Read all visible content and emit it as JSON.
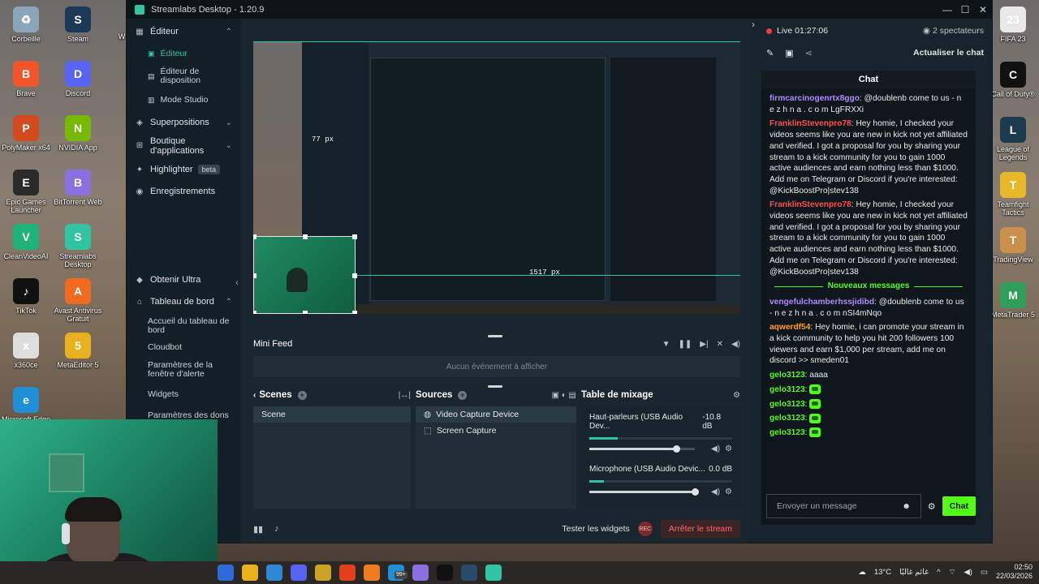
{
  "desktop": {
    "icons_left": [
      {
        "label": "Corbeille",
        "name": "recycle-bin-icon",
        "color": "#8aa4b8",
        "glyph": "♻"
      },
      {
        "label": "Brave",
        "name": "brave-icon",
        "color": "#f1562b",
        "glyph": "B"
      },
      {
        "label": "PolyMaker x64",
        "name": "polymaker-icon",
        "color": "#d34a1f",
        "glyph": "P"
      },
      {
        "label": "Epic Games Launcher",
        "name": "epic-games-icon",
        "color": "#2a2a2a",
        "glyph": "E"
      },
      {
        "label": "CleanVideoAI",
        "name": "cleanvideoai-icon",
        "color": "#1db37b",
        "glyph": "V"
      },
      {
        "label": "TikTok",
        "name": "tiktok-icon",
        "color": "#111111",
        "glyph": "♪"
      },
      {
        "label": "x360ce",
        "name": "x360ce-icon",
        "color": "#dddddd",
        "glyph": "x"
      },
      {
        "label": "Microsoft Edge",
        "name": "edge-icon",
        "color": "#1f8fd6",
        "glyph": "e"
      }
    ],
    "icons_col2": [
      {
        "label": "Steam",
        "name": "steam-icon",
        "color": "#1b3a57",
        "glyph": "S"
      },
      {
        "label": "Discord",
        "name": "discord-icon",
        "color": "#5865f2",
        "glyph": "D"
      },
      {
        "label": "NVIDIA App",
        "name": "nvidia-icon",
        "color": "#76b900",
        "glyph": "N"
      },
      {
        "label": "BitTorrent Web",
        "name": "bittorrent-icon",
        "color": "#8a6fe0",
        "glyph": "B"
      },
      {
        "label": "Streamlabs Desktop",
        "name": "streamlabs-icon",
        "color": "#31c3a2",
        "glyph": "S"
      },
      {
        "label": "Avast Antivirus Gratuit",
        "name": "avast-icon",
        "color": "#f06b1f",
        "glyph": "A"
      },
      {
        "label": "MetaEditor 5",
        "name": "metaeditor-icon",
        "color": "#e8b11f",
        "glyph": "5"
      }
    ],
    "icons_right": [
      {
        "label": "FIFA 23",
        "name": "fifa-icon",
        "color": "#e8e8e8",
        "glyph": "23"
      },
      {
        "label": "Call of Duty®",
        "name": "cod-icon",
        "color": "#111111",
        "glyph": "C"
      },
      {
        "label": "League of Legends",
        "name": "lol-icon",
        "color": "#1c3b4f",
        "glyph": "L"
      },
      {
        "label": "Teamfight Tactics",
        "name": "tft-icon",
        "color": "#e6b82a",
        "glyph": "T"
      },
      {
        "label": "TradingView",
        "name": "tradingview-icon",
        "color": "#c8904a",
        "glyph": "T"
      },
      {
        "label": "MetaTrader 5",
        "name": "metatrader-icon",
        "color": "#2f9e5a",
        "glyph": "M"
      }
    ],
    "partial_label": "W"
  },
  "app": {
    "title": "Streamlabs Desktop - 1.20.9",
    "buttons": {
      "minimize": "—",
      "maximize": "☐",
      "close": "✕"
    }
  },
  "sidebar": {
    "editeur": "Éditeur",
    "editeur_sub": [
      "Éditeur",
      "Éditeur de disposition",
      "Mode Studio"
    ],
    "superpositions": "Superpositions",
    "boutique": "Boutique d'applications",
    "highlighter": "Highlighter",
    "beta": "beta",
    "enregistrements": "Enregistrements",
    "obtenir_ultra": "Obtenir Ultra",
    "tableau": "Tableau de bord",
    "tableau_sub": [
      "Accueil du tableau de bord",
      "Cloudbot",
      "Paramètres de la fenêtre d'alerte",
      "Widgets",
      "Paramètres des dons"
    ]
  },
  "preview": {
    "px_label_1": "77 px",
    "px_label_2": "1517 px"
  },
  "minifeed": {
    "title": "Mini Feed",
    "empty": "Aucun événement à afficher"
  },
  "scenes": {
    "title": "Scenes",
    "items": [
      "Scene"
    ]
  },
  "sources": {
    "title": "Sources",
    "items": [
      "Video Capture Device",
      "Screen Capture"
    ]
  },
  "mixer": {
    "title": "Table de mixage",
    "channels": [
      {
        "name": "Haut-parleurs (USB Audio Dev...",
        "db": "-10.8 dB",
        "meter": 0.2,
        "volume": 0.82
      },
      {
        "name": "Microphone (USB Audio Devic...",
        "db": "0.0 dB",
        "meter": 0.1,
        "volume": 1.0
      }
    ]
  },
  "footer": {
    "test_widgets": "Tester les widgets",
    "rec": "REC",
    "stop": "Arrêter le stream"
  },
  "chatpanel": {
    "live": "Live 01:27:06",
    "viewers": "2 spectateurs",
    "refresh": "Actualiser le chat",
    "chat_title": "Chat",
    "messages": [
      {
        "user": "firmcarcinogenrtx8ggo",
        "color": "#b388ff",
        "text": "@doublenb come to us - n e z h n a . c o m LgFRXXi"
      },
      {
        "user": "FranklinStevenpro78",
        "color": "#ff4d4d",
        "text": "Hey homie, I checked your videos seems like you are new in kick not yet affiliated and verified. I got a proposal for you by sharing your stream to a kick community for you to gain 1000 active audiences and earn nothing less than $1000. Add me on Telegram or Discord if you're interested: @KickBoostPro|stev138"
      },
      {
        "user": "FranklinStevenpro78",
        "color": "#ff4d4d",
        "text": "Hey homie, I checked your videos seems like you are new in kick not yet affiliated and verified. I got a proposal for you by sharing your stream to a kick community for you to gain 1000 active audiences and earn nothing less than $1000. Add me on Telegram or Discord if you're interested: @KickBoostPro|stev138"
      }
    ],
    "new_messages": "Nouveaux messages",
    "new": [
      {
        "user": "vengefulchamberhssjidibd",
        "color": "#b388ff",
        "text": "@doublenb come to us - n e z h n a . c o m nSI4mNqo"
      },
      {
        "user": "aqwerdf54",
        "color": "#ff9d2a",
        "text": "Hey homie, i can promote your stream in a kick community to help you hit 200 followers 100 viewers and earn $1,000 per stream, add me on discord >> smeden01"
      },
      {
        "user": "gelo3123",
        "color": "#53fc18",
        "text": "aaaa"
      },
      {
        "user": "gelo3123",
        "color": "#53fc18",
        "text": ""
      },
      {
        "user": "gelo3123",
        "color": "#53fc18",
        "text": ""
      },
      {
        "user": "gelo3123",
        "color": "#53fc18",
        "text": ""
      },
      {
        "user": "gelo3123",
        "color": "#53fc18",
        "text": ""
      }
    ],
    "input_placeholder": "Envoyer un message",
    "send": "Chat"
  },
  "taskbar": {
    "weather": "13°C",
    "weather_desc": "غائم غالبًا",
    "time": "02:50",
    "date": "22/03/2026",
    "badge": "99+"
  }
}
